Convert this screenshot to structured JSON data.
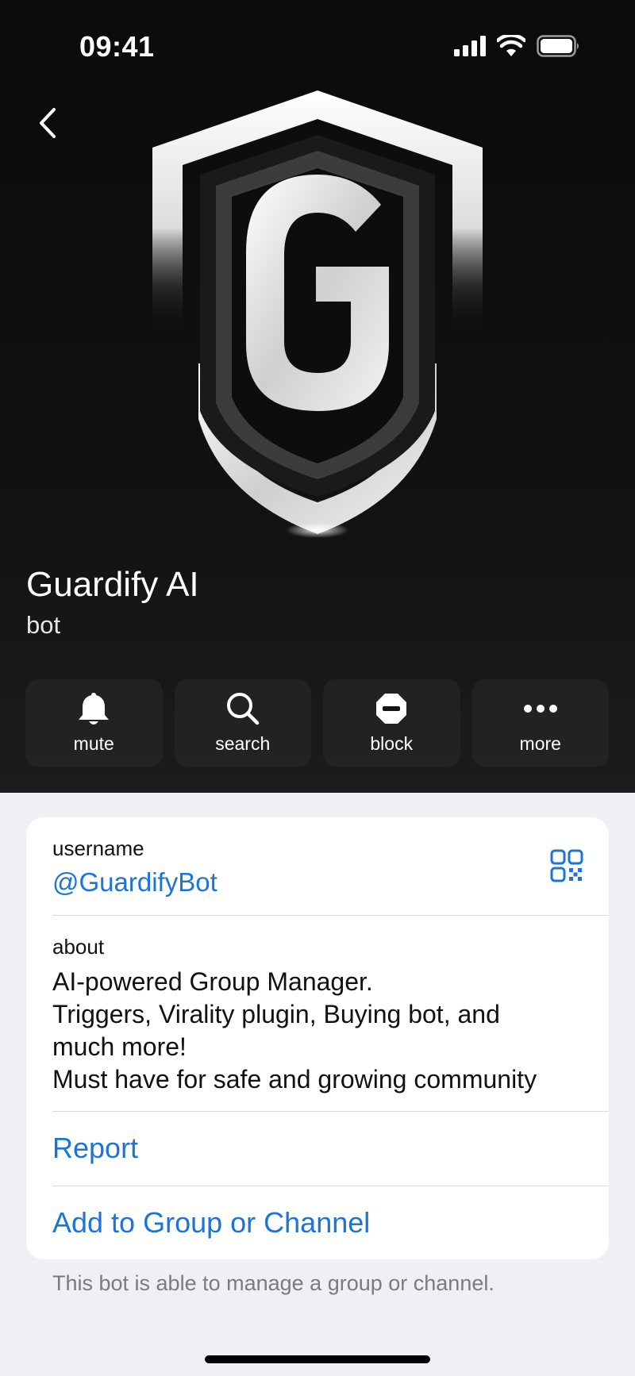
{
  "status_bar": {
    "time": "09:41"
  },
  "profile": {
    "name": "Guardify AI",
    "subtitle": "bot"
  },
  "actions": [
    {
      "label": "mute",
      "icon": "bell-icon"
    },
    {
      "label": "search",
      "icon": "search-icon"
    },
    {
      "label": "block",
      "icon": "block-icon"
    },
    {
      "label": "more",
      "icon": "more-icon"
    }
  ],
  "info": {
    "username_label": "username",
    "username_value": "@GuardifyBot",
    "about_label": "about",
    "about_lines": [
      "AI-powered Group Manager.",
      "Triggers, Virality plugin, Buying bot, and",
      "much more!",
      "Must have for safe and growing community"
    ],
    "report_label": "Report",
    "add_label": "Add to Group or Channel",
    "footer_note": "This bot is able to manage a group or channel."
  },
  "colors": {
    "accent": "#1d74d8",
    "hero_bg": "#0b0b0b",
    "page_bg": "#efeff4"
  }
}
